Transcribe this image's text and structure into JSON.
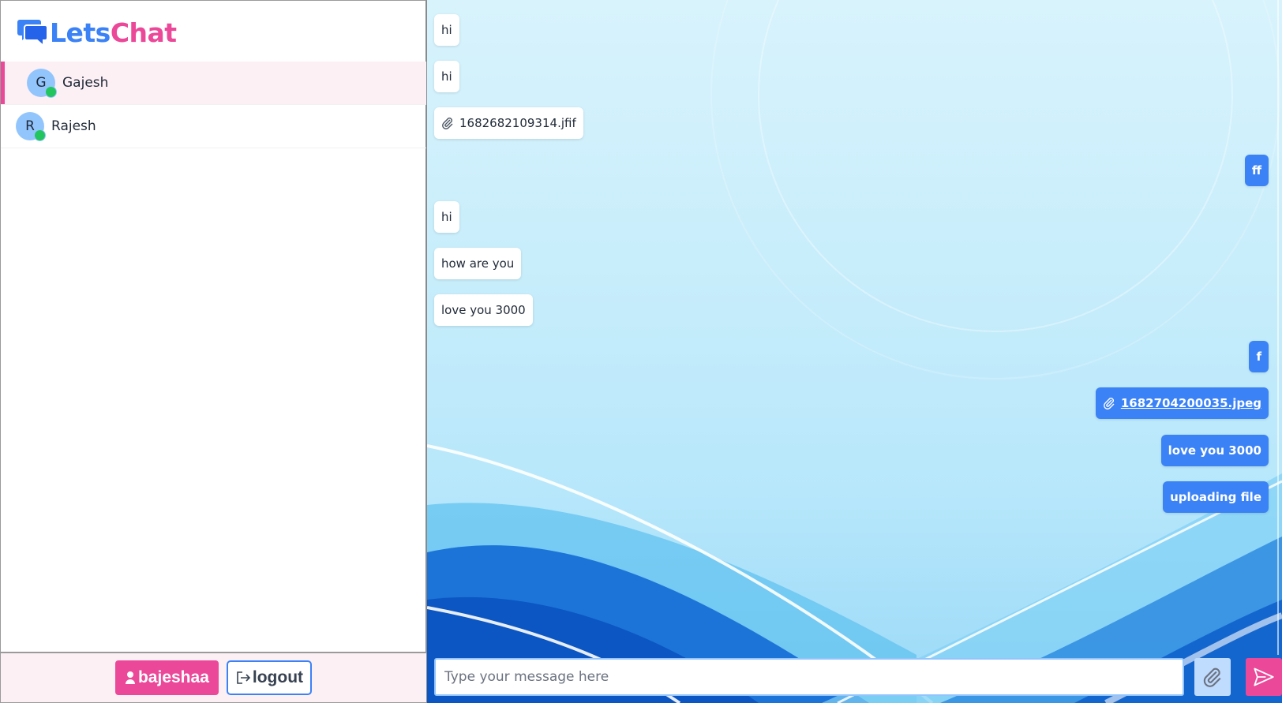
{
  "app": {
    "logo_part1": "Lets",
    "logo_part2": "Chat"
  },
  "contacts": [
    {
      "initial": "G",
      "name": "Gajesh",
      "online": true,
      "active": true
    },
    {
      "initial": "R",
      "name": "Rajesh",
      "online": true,
      "active": false
    }
  ],
  "footer": {
    "username": "bajeshaa",
    "logout_label": "logout",
    "user_icon": "user-icon",
    "logout_icon": "logout-icon"
  },
  "messages": [
    {
      "direction": "in",
      "type": "text",
      "text": "hi"
    },
    {
      "direction": "in",
      "type": "text",
      "text": "hi"
    },
    {
      "direction": "in",
      "type": "file",
      "text": "1682682109314.jfif"
    },
    {
      "direction": "out",
      "type": "text",
      "text": "ff"
    },
    {
      "direction": "in",
      "type": "text",
      "text": "hi"
    },
    {
      "direction": "in",
      "type": "text",
      "text": "how are you"
    },
    {
      "direction": "in",
      "type": "text",
      "text": "love you 3000"
    },
    {
      "direction": "out",
      "type": "text",
      "text": "f"
    },
    {
      "direction": "out",
      "type": "file",
      "text": "1682704200035.jpeg"
    },
    {
      "direction": "out",
      "type": "text",
      "text": "love you 3000"
    },
    {
      "direction": "out",
      "type": "text",
      "text": "uploading file"
    }
  ],
  "composer": {
    "placeholder": "Type your message here",
    "value": "",
    "attach_icon": "paperclip-icon",
    "send_icon": "send-icon"
  },
  "colors": {
    "brand_blue": "#3b82f6",
    "brand_pink": "#ec4899",
    "online": "#22c55e"
  }
}
